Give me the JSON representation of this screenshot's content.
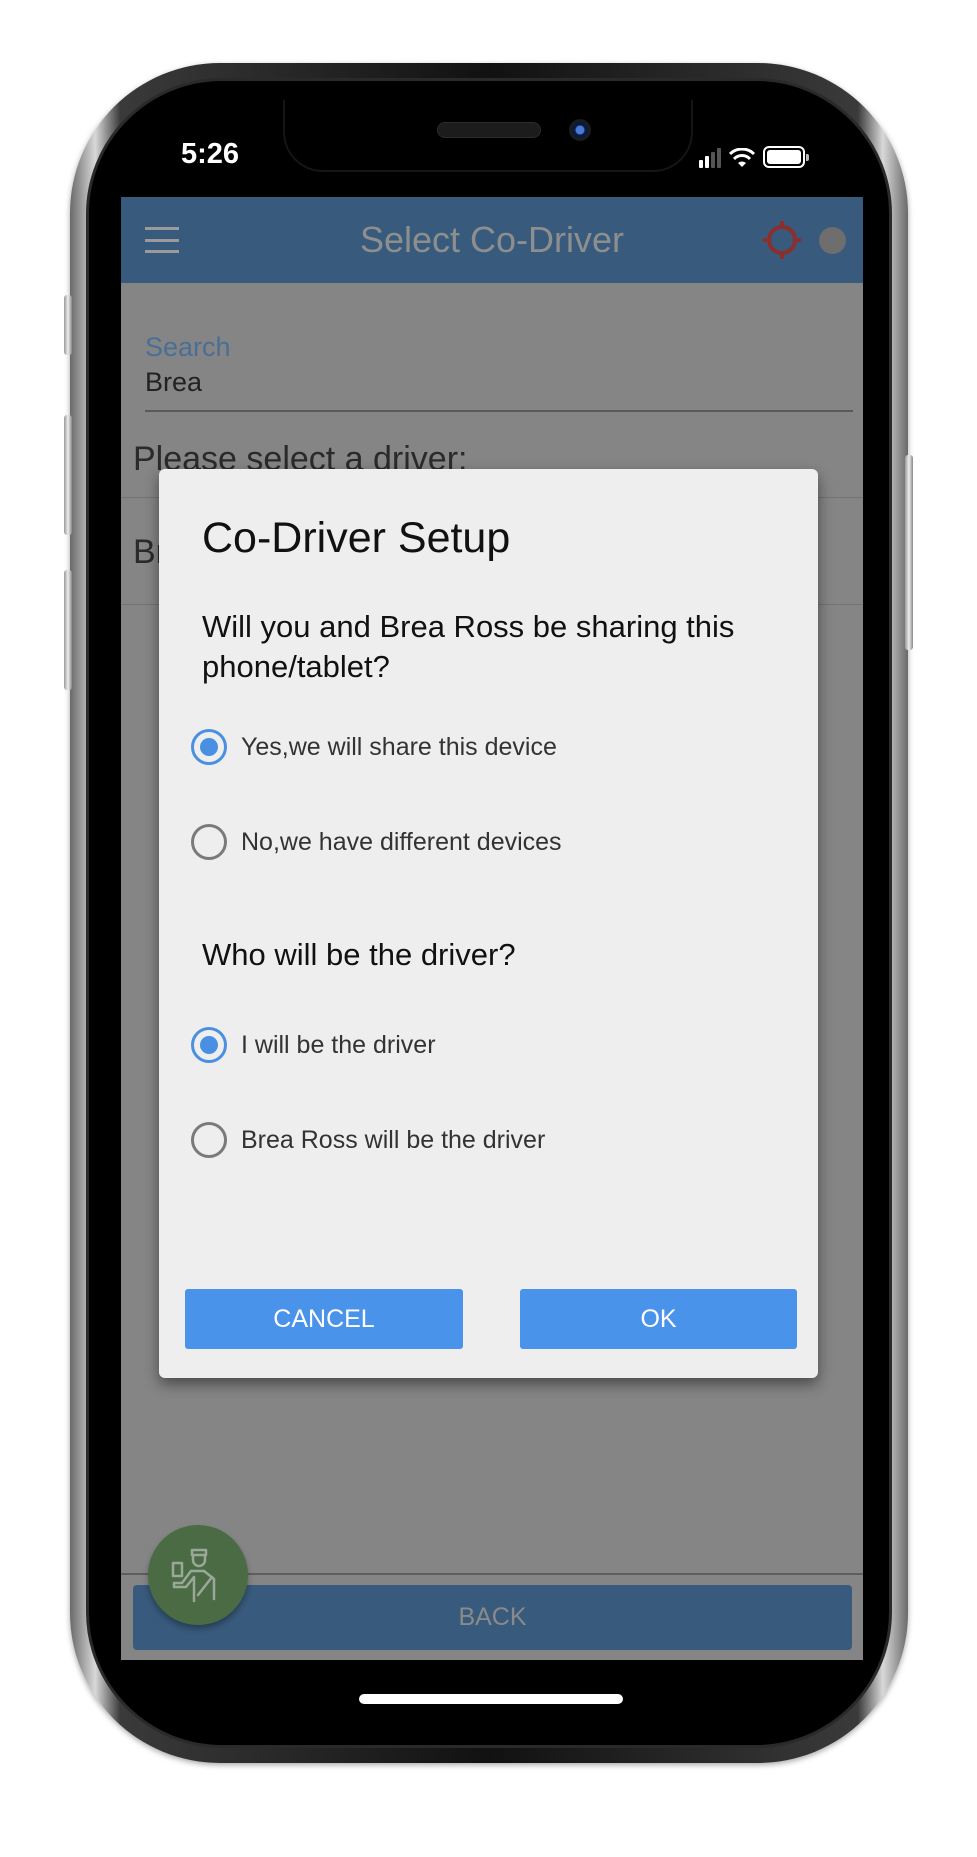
{
  "status_bar": {
    "time": "5:26",
    "icons": [
      "cellular-signal-icon",
      "wifi-icon",
      "battery-icon"
    ]
  },
  "app_bar": {
    "title": "Select Co-Driver",
    "menu_icon": "hamburger-menu-icon",
    "gps_icon": "gps-crosshair-icon",
    "status_indicator": "connection-status-dot",
    "colors": {
      "bar": "#385a7c",
      "gps": "#8b2e2e"
    }
  },
  "search": {
    "label": "Search",
    "value": "Brea"
  },
  "driver_list": {
    "prompt": "Please select a driver:",
    "items": [
      {
        "name": "Brea Ross"
      }
    ]
  },
  "back_button": {
    "label": "BACK"
  },
  "fab": {
    "icon": "driver-person-icon",
    "color": "#4a6b43"
  },
  "dialog": {
    "title": "Co-Driver Setup",
    "question_share": "Will you and Brea Ross be sharing this phone/tablet?",
    "share_options": [
      {
        "label": "Yes,we will share this device",
        "checked": true
      },
      {
        "label": "No,we have different devices",
        "checked": false
      }
    ],
    "question_driver": "Who will be the driver?",
    "driver_options": [
      {
        "label": "I will be the driver",
        "checked": true
      },
      {
        "label": "Brea Ross will be the driver",
        "checked": false
      }
    ],
    "cancel_label": "CANCEL",
    "ok_label": "OK",
    "accent_color": "#4a93ea"
  }
}
